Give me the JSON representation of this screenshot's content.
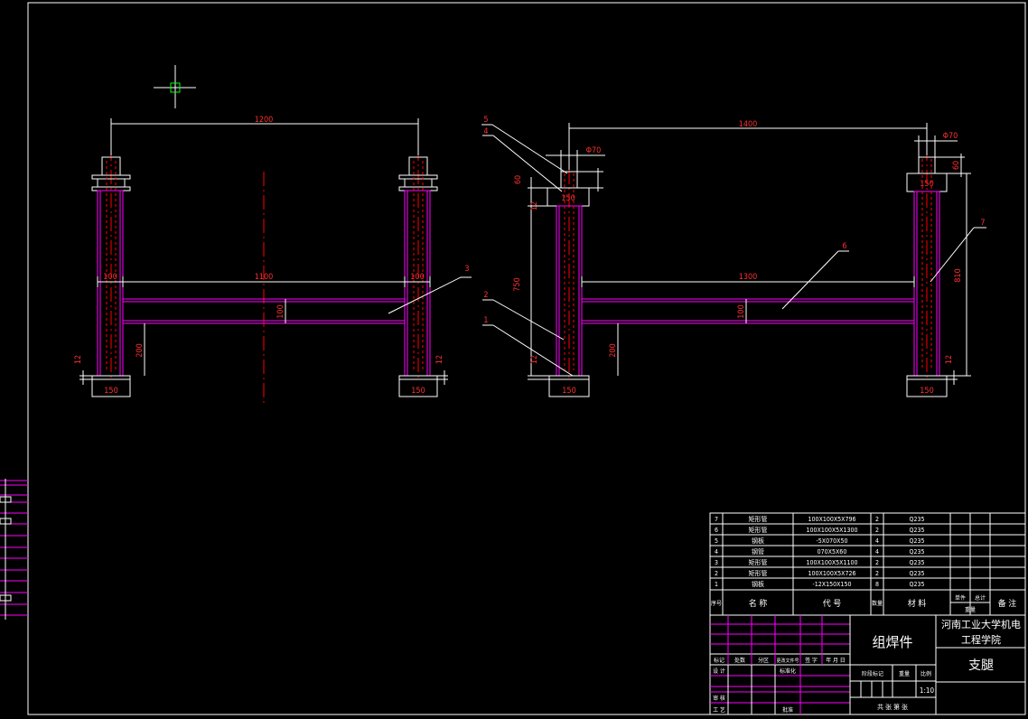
{
  "colors": {
    "background": "#000000",
    "frame": "#ffffff",
    "dimension": "#ffffff",
    "outline": "#ff00ff",
    "steel_edge": "#ffffff",
    "centerline": "#ff0000",
    "hidden_line": "#ff0000",
    "text_red": "#ff3030",
    "text_white": "#ffffff",
    "cursor": "#ffffff",
    "snap_box": "#00ff00"
  },
  "cursor": {
    "icon": "crosshair-icon"
  },
  "front_view": {
    "dims": {
      "span_top": "1200",
      "span_beam": "1100",
      "post_left": "100",
      "post_right": "100",
      "beam_height": "100",
      "beam_to_floor": "200",
      "base_thk_left": "12",
      "base_thk_right": "12",
      "base_left": "150",
      "base_right": "150"
    },
    "callouts": {
      "beam": "3"
    }
  },
  "side_view": {
    "dims": {
      "span_top": "1400",
      "span_beam": "1300",
      "pin_dia_left": "Φ70",
      "pin_dia_right": "Φ70",
      "pin_height_left": "60",
      "pin_height_right": "60",
      "cap_thk_left": "12",
      "cap_left": "150",
      "cap_right": "150",
      "post_height_left": "750",
      "post_height_right": "810",
      "beam_height": "100",
      "beam_to_floor": "200",
      "base_thk_left": "12",
      "base_thk_right": "12",
      "base_left": "150",
      "base_right": "150"
    },
    "callouts": {
      "pin": "5",
      "cap": "4",
      "post_left": "2",
      "base": "1",
      "beam": "6",
      "post_right": "7"
    }
  },
  "title_block": {
    "bom_rows": [
      {
        "no": "7",
        "name": "矩形管",
        "spec": "100X100X5X796",
        "qty": "2",
        "material": "Q235"
      },
      {
        "no": "6",
        "name": "矩形管",
        "spec": "100X100X5X1300",
        "qty": "2",
        "material": "Q235"
      },
      {
        "no": "5",
        "name": "钢板",
        "spec": "-5X070X50",
        "qty": "4",
        "material": "Q235"
      },
      {
        "no": "4",
        "name": "钢管",
        "spec": "070X5X60",
        "qty": "4",
        "material": "Q235"
      },
      {
        "no": "3",
        "name": "矩形管",
        "spec": "100X100X5X1100",
        "qty": "2",
        "material": "Q235"
      },
      {
        "no": "2",
        "name": "矩形管",
        "spec": "100X100X5X726",
        "qty": "2",
        "material": "Q235"
      },
      {
        "no": "1",
        "name": "钢板",
        "spec": "-12X150X150",
        "qty": "8",
        "material": "Q235"
      }
    ],
    "header": {
      "no": "序号",
      "name": "名 称",
      "code": "代 号",
      "qty": "数量",
      "material": "材 料",
      "unit_weight": "单件",
      "total_weight": "总计",
      "weight": "重量",
      "remark": "备 注"
    },
    "assembly": "组焊件",
    "school_line1": "河南工业大学机电",
    "school_line2": "工程学院",
    "part_name": "支腿",
    "change_labels": {
      "mark": "标记",
      "count": "处数",
      "zone": "分区",
      "doc": "更改文件号",
      "sign": "签 字",
      "date": "年 月 日"
    },
    "role_labels": {
      "design": "设 计",
      "standard": "标准化",
      "review": "审 核",
      "process": "工 艺",
      "approve": "批准"
    },
    "stage_label": "阶段标记",
    "weight_label": "重量",
    "scale_label": "比例",
    "scale": "1:10",
    "sheets": "共  张  第  张"
  }
}
